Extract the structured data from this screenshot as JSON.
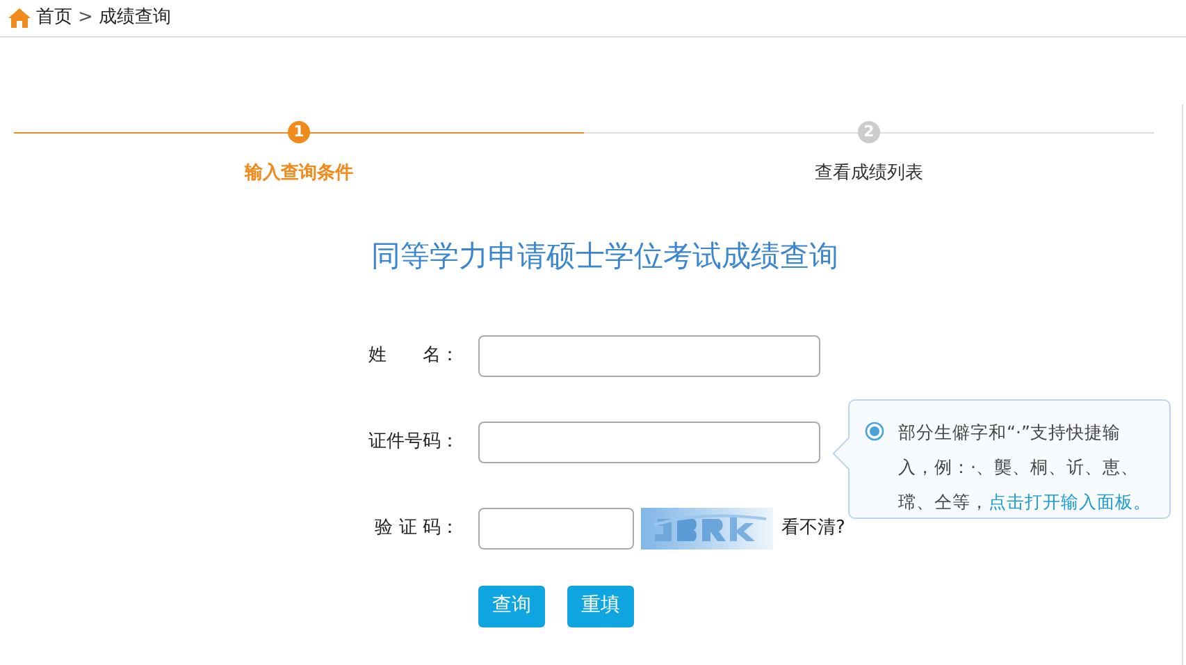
{
  "breadcrumb": [
    {
      "text": "首页",
      "kind": "link"
    },
    {
      "text": ">",
      "kind": "separator"
    },
    {
      "text": "成绩查询",
      "kind": "current"
    }
  ],
  "steps": [
    {
      "number": "1",
      "label": "输入查询条件",
      "selected": true
    },
    {
      "number": "2",
      "label": "查看成绩列表",
      "selected": false
    }
  ],
  "title": "同等学力申请硕士学位考试成绩查询",
  "fields": [
    {
      "label": "姓　　名：",
      "kind": "text"
    },
    {
      "label": "证件号码：",
      "kind": "text"
    },
    {
      "label": "验 证 码：",
      "kind": "captcha",
      "refresh_link": "看不清?"
    }
  ],
  "tip": {
    "text": "部分生僻字和“·”支持快捷输入，例：·、龑、桐、䜣、恵、瑺、仝等，",
    "link": "点击打开输入面板。"
  },
  "buttons": [
    "查询",
    "重填"
  ]
}
